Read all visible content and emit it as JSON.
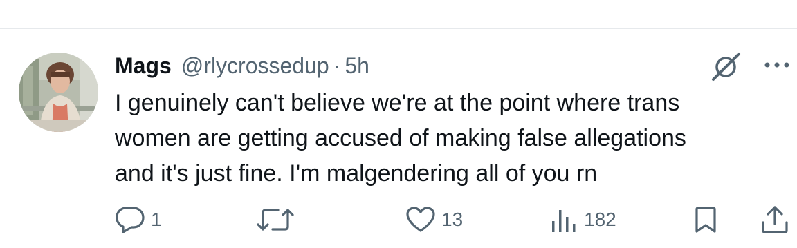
{
  "tweet": {
    "author_name": "Mags",
    "author_handle": "@rlycrossedup",
    "separator": "·",
    "timestamp": "5h",
    "text_lines": [
      "I genuinely can't believe we're at the point where trans",
      "women are getting accused of making false allegations",
      "and it's just fine. I'm malgendering all of you rn"
    ]
  },
  "actions": {
    "reply_count": "1",
    "likes_count": "13",
    "views_count": "182"
  },
  "icons": {
    "grok": "grok-icon",
    "more": "more-options-icon",
    "reply": "reply-icon",
    "retweet": "retweet-icon",
    "like": "heart-icon",
    "views": "views-bar-chart-icon",
    "bookmark": "bookmark-icon",
    "share": "share-icon"
  },
  "colors": {
    "text_primary": "#0f1419",
    "text_secondary": "#536471",
    "divider": "#e6e9ec"
  }
}
